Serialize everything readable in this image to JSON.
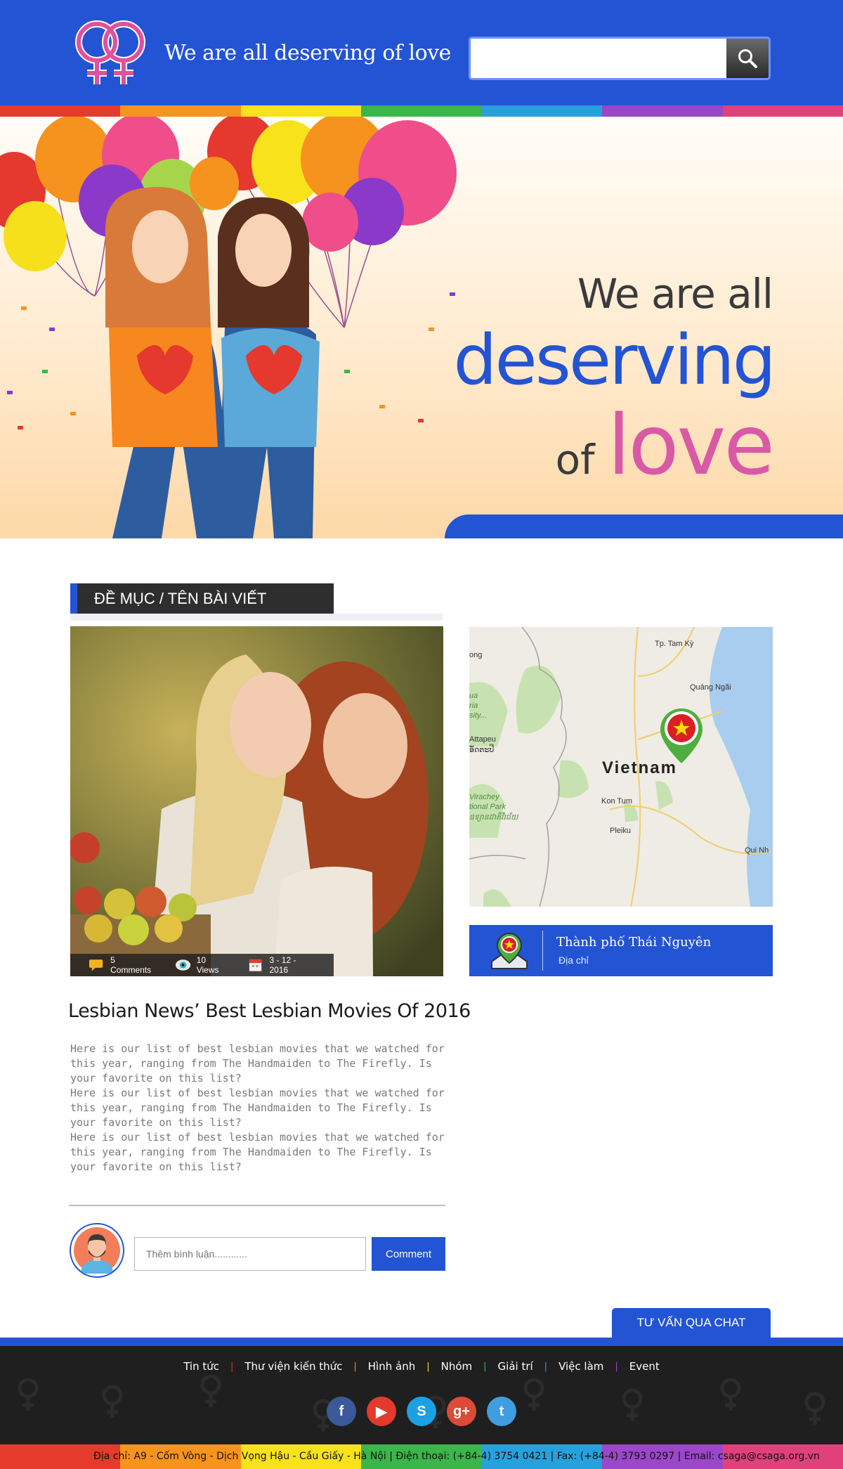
{
  "header": {
    "brand_text": "We are all deserving of love",
    "search_placeholder": "",
    "search_icon": "search-icon"
  },
  "colors": {
    "brand_blue": "#2354d4",
    "love_pink": "#d85aa6",
    "rainbow": [
      "#e53a2c",
      "#f7941d",
      "#f7e21b",
      "#3cb54a",
      "#27a1dc",
      "#1f62c4",
      "#9b47c9",
      "#e2407b"
    ]
  },
  "hero": {
    "line1": "We are all",
    "line2": "deserving",
    "line3_small": "of",
    "line3_big": "love"
  },
  "section": {
    "title_main": "ĐỀ MỤC",
    "title_sep": " / ",
    "title_sub": "TÊN BÀI VIẾT"
  },
  "article": {
    "comments": "5 Comments",
    "views": "10 Views",
    "date": "3 - 12 - 2016",
    "title": "Lesbian News’ Best Lesbian Movies Of 2016",
    "paragraphs": [
      "Here is our list of best lesbian movies that we watched for this year, ranging from The Handmaiden to The Firefly. Is your favorite on this list?",
      "Here is our list of best lesbian movies that we watched for this year, ranging from The Handmaiden to The Firefly. Is your favorite on this list?",
      "Here is our list of best lesbian movies that we watched for this year, ranging from The Handmaiden to The Firefly. Is your favorite on this list?"
    ]
  },
  "comment": {
    "placeholder": "Thêm bình luận............",
    "button": "Comment"
  },
  "map": {
    "country": "Vietnam",
    "places": [
      "Tp. Tam Kỳ",
      "Quảng Ngãi",
      "Kon Tum",
      "Pleiku",
      "Qui Nh",
      "Attapeu",
      "ອັດຕະປື",
      "Virachey",
      "tional Park",
      "ឧទ្យានជាតិវីរជ័យ",
      "ong",
      "ua",
      "ria",
      "sity..."
    ]
  },
  "location": {
    "name": "Thành phố Thái Nguyên",
    "sub": "Địa chỉ"
  },
  "chat": {
    "label": "TƯ VẤN QUA CHAT"
  },
  "footer": {
    "nav": [
      "Tin tức",
      "Thư viện kiến thức",
      "Hình ảnh",
      "Nhóm",
      "Giải trí",
      "Việc làm",
      "Event"
    ],
    "sep_colors": [
      "#e53a2c",
      "#f7941d",
      "#f7e21b",
      "#3cb54a",
      "#27a1dc",
      "#9b47c9"
    ],
    "socials": [
      {
        "name": "facebook-icon",
        "glyph": "f",
        "color": "#3b5998"
      },
      {
        "name": "youtube-icon",
        "glyph": "▶",
        "color": "#e33a2c"
      },
      {
        "name": "skype-icon",
        "glyph": "S",
        "color": "#1da0e3"
      },
      {
        "name": "google-plus-icon",
        "glyph": "g+",
        "color": "#dc4a38"
      },
      {
        "name": "twitter-icon",
        "glyph": "t",
        "color": "#3f9de0"
      }
    ],
    "address": "Địa chỉ: A9 - Cốm Vòng - Dịch Vọng Hậu - Cầu Giấy - Hà Nội | Điện thoại: (+84-4) 3754 0421 | Fax: (+84-4) 3793 0297 | Email: csaga@csaga.org.vn"
  }
}
